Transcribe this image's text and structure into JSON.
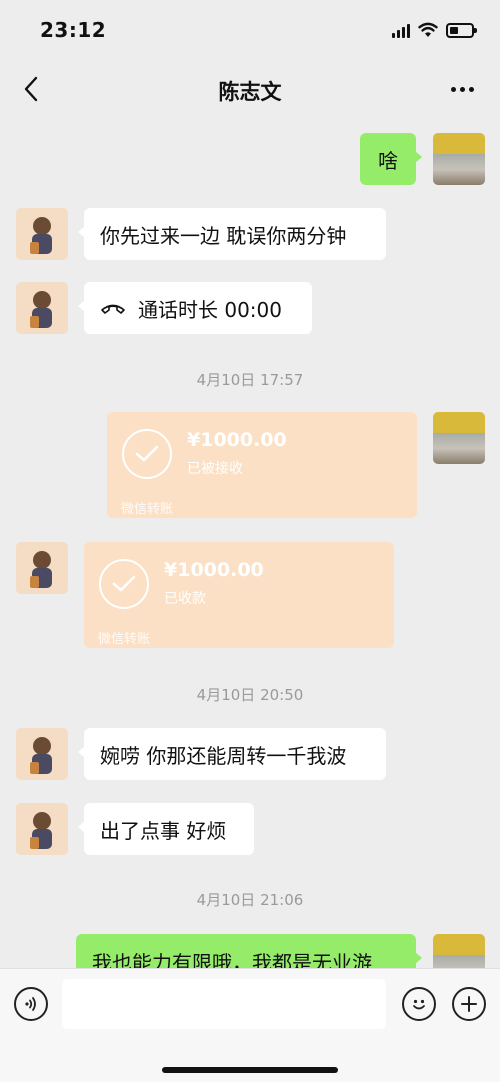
{
  "status_bar": {
    "time": "23:12"
  },
  "header": {
    "title": "陈志文"
  },
  "messages": [
    {
      "from": "me",
      "text": "啥"
    },
    {
      "from": "other",
      "text": "你先过来一边 耽误你两分钟"
    },
    {
      "from": "other",
      "text": "通话时长 00:00"
    },
    {
      "divider": "4月10日 17:57"
    },
    {
      "from": "me",
      "amount": "¥1000.00",
      "status": "已被接收",
      "footer": "微信转账"
    },
    {
      "from": "other",
      "amount": "¥1000.00",
      "status": "已收款",
      "footer": "微信转账"
    },
    {
      "divider": "4月10日 20:50"
    },
    {
      "from": "other",
      "text": "婉唠 你那还能周转一千我波"
    },
    {
      "from": "other",
      "text": "出了点事 好烦"
    },
    {
      "divider": "4月10日 21:06"
    },
    {
      "from": "me",
      "text": "我也能力有限哦，我都是无业游"
    }
  ],
  "colors": {
    "me_bubble": "#95ec69",
    "other_bubble": "#ffffff",
    "transfer_bg": "#fbe0c5",
    "background": "#ededed"
  },
  "icons": {
    "back": "chevron-left-icon",
    "more": "more-dots-icon",
    "voice": "voice-icon",
    "emoji": "emoji-icon",
    "add": "plus-icon",
    "call": "phone-hangup-icon",
    "check": "check-icon"
  }
}
